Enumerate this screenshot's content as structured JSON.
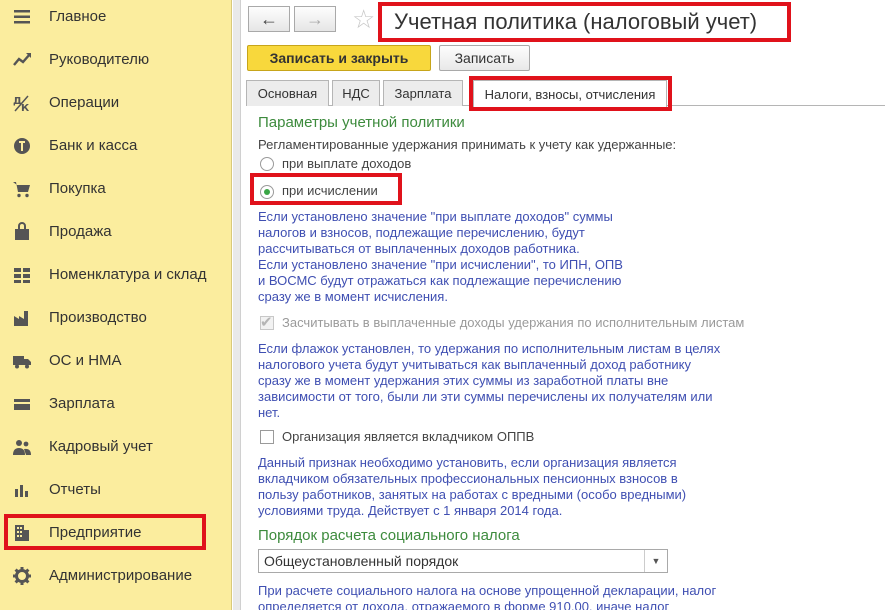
{
  "sidebar": {
    "items": [
      {
        "label": "Главное",
        "icon": "menu-icon"
      },
      {
        "label": "Руководителю",
        "icon": "trend-chart-icon"
      },
      {
        "label": "Операции",
        "icon": "operations-icon"
      },
      {
        "label": "Банк и касса",
        "icon": "coin-icon"
      },
      {
        "label": "Покупка",
        "icon": "cart-icon"
      },
      {
        "label": "Продажа",
        "icon": "bag-icon"
      },
      {
        "label": "Номенклатура и склад",
        "icon": "warehouse-icon"
      },
      {
        "label": "Производство",
        "icon": "factory-icon"
      },
      {
        "label": "ОС и НМА",
        "icon": "truck-icon"
      },
      {
        "label": "Зарплата",
        "icon": "wallet-icon"
      },
      {
        "label": "Кадровый учет",
        "icon": "people-icon"
      },
      {
        "label": "Отчеты",
        "icon": "bar-chart-icon"
      },
      {
        "label": "Предприятие",
        "icon": "building-icon"
      },
      {
        "label": "Администрирование",
        "icon": "gear-icon"
      }
    ]
  },
  "window": {
    "title": "Учетная политика (налоговый учет)",
    "back": "←",
    "forward": "→",
    "favorite": "☆"
  },
  "toolbar": {
    "save_close_label": "Записать и закрыть",
    "save_label": "Записать"
  },
  "tabs": [
    {
      "label": "Основная"
    },
    {
      "label": "НДС"
    },
    {
      "label": "Зарплата"
    },
    {
      "label": "Налоги, взносы, отчисления"
    }
  ],
  "form": {
    "section1_title": "Параметры учетной политики",
    "withholding_label": "Регламентированные удержания принимать к учету как удержанные:",
    "radio_on_payment": "при выплате доходов",
    "radio_on_accrual": "при исчислении",
    "help1": [
      "Если установлено значение \"при выплате доходов\" суммы",
      "налогов и взносов, подлежащие перечислению, будут",
      "рассчитываться от выплаченных доходов работника.",
      "Если установлено значение \"при исчислении\", то ИПН, ОПВ",
      "и ВОСМС будут отражаться как подлежащие перечислению",
      "сразу же в момент исчисления."
    ],
    "checkbox_writs": "Засчитывать в выплаченные доходы удержания по исполнительным листам",
    "help2": [
      "Если флажок установлен, то удержания по исполнительным листам в целях",
      "налогового учета будут учитываться как выплаченный доход работнику",
      "сразу же в момент удержания этих суммы из заработной платы вне",
      "зависимости от того, были ли эти суммы перечислены их получателям или",
      "нет."
    ],
    "checkbox_oppv": "Организация является вкладчиком ОППВ",
    "help3": [
      "Данный признак необходимо установить, если организация является",
      "вкладчиком обязательных профессиональных пенсионных взносов в",
      "пользу работников, занятых на работах с вредными (особо вредными)",
      "условиями труда. Действует с 1 января 2014 года."
    ],
    "section2_title": "Порядок расчета социального налога",
    "social_tax_select": "Общеустановленный порядок",
    "help4": [
      "При расчете социального налога на основе упрощенной декларации, налог",
      "определяется от дохода, отражаемого в форме 910.00, иначе налог"
    ]
  },
  "colors": {
    "sidebar_bg": "#fbed9e",
    "highlight": "#e0121b",
    "accent_green": "#3d8b3d",
    "help_blue": "#3f4fb2",
    "primary_button": "#f8d83c"
  }
}
